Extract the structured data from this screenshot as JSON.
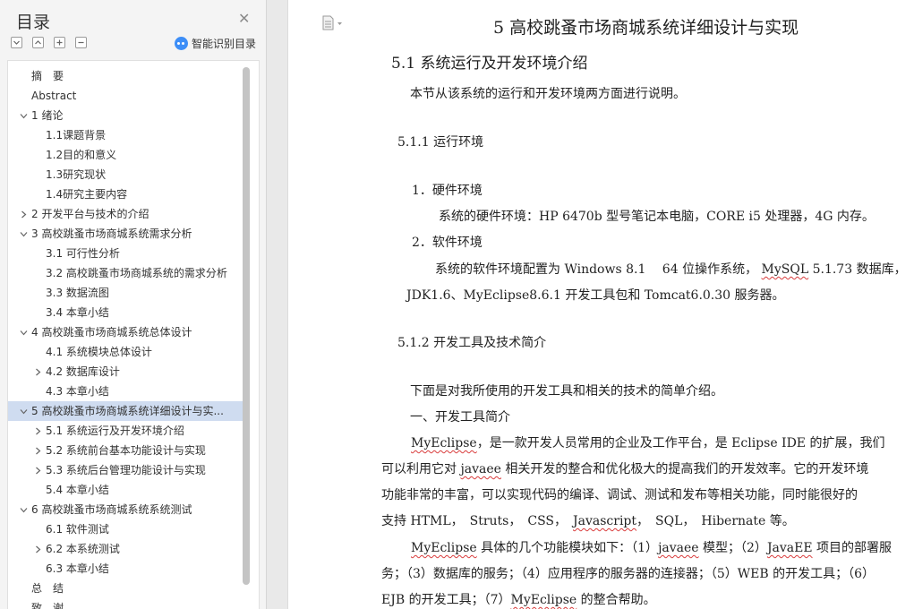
{
  "nav": {
    "title": "目录",
    "smart_toc_label": "智能识别目录",
    "items": [
      {
        "label": "摘　要",
        "level": 0,
        "expander": "none"
      },
      {
        "label": "Abstract",
        "level": 0,
        "expander": "none"
      },
      {
        "label": "1 绪论",
        "level": 0,
        "expander": "expanded"
      },
      {
        "label": "1.1课题背景",
        "level": 1,
        "expander": "none"
      },
      {
        "label": "1.2目的和意义",
        "level": 1,
        "expander": "none"
      },
      {
        "label": "1.3研究现状",
        "level": 1,
        "expander": "none"
      },
      {
        "label": "1.4研究主要内容",
        "level": 1,
        "expander": "none"
      },
      {
        "label": "2 开发平台与技术的介绍",
        "level": 0,
        "expander": "collapsed"
      },
      {
        "label": "3  高校跳蚤市场商城系统需求分析",
        "level": 0,
        "expander": "expanded"
      },
      {
        "label": "3.1 可行性分析",
        "level": 1,
        "expander": "none"
      },
      {
        "label": "3.2 高校跳蚤市场商城系统的需求分析",
        "level": 1,
        "expander": "none"
      },
      {
        "label": "3.3 数据流图",
        "level": 1,
        "expander": "none"
      },
      {
        "label": "3.4 本章小结",
        "level": 1,
        "expander": "none"
      },
      {
        "label": "4  高校跳蚤市场商城系统总体设计",
        "level": 0,
        "expander": "expanded"
      },
      {
        "label": "4.1 系统模块总体设计",
        "level": 1,
        "expander": "none"
      },
      {
        "label": "4.2 数据库设计",
        "level": 1,
        "expander": "collapsed"
      },
      {
        "label": "4.3 本章小结",
        "level": 1,
        "expander": "none"
      },
      {
        "label": "5  高校跳蚤市场商城系统详细设计与实...",
        "level": 0,
        "expander": "expanded",
        "active": true
      },
      {
        "label": "5.1 系统运行及开发环境介绍",
        "level": 1,
        "expander": "collapsed"
      },
      {
        "label": "5.2 系统前台基本功能设计与实现",
        "level": 1,
        "expander": "collapsed"
      },
      {
        "label": "5.3 系统后台管理功能设计与实现",
        "level": 1,
        "expander": "collapsed"
      },
      {
        "label": "5.4 本章小结",
        "level": 1,
        "expander": "none"
      },
      {
        "label": "6  高校跳蚤市场商城系统系统测试",
        "level": 0,
        "expander": "expanded"
      },
      {
        "label": "6.1 软件测试",
        "level": 1,
        "expander": "none"
      },
      {
        "label": "6.2 本系统测试",
        "level": 1,
        "expander": "collapsed"
      },
      {
        "label": "6.3 本章小结",
        "level": 1,
        "expander": "none"
      },
      {
        "label": "总　结",
        "level": 0,
        "expander": "none"
      },
      {
        "label": "致　谢",
        "level": 0,
        "expander": "none"
      }
    ]
  },
  "doc": {
    "chapter_title": "5  高校跳蚤市场商城系统详细设计与实现",
    "section_51": "5.1 系统运行及开发环境介绍",
    "intro": "本节从该系统的运行和开发环境两方面进行说明。",
    "sub_511": "5.1.1 运行环境",
    "hw_title": "1．硬件环境",
    "hw_body": "系统的硬件环境：HP 6470b 型号笔记本电脑，CORE i5 处理器，4G 内存。",
    "sw_title": "2．软件环境",
    "sw_body_1a": "系统的软件环境配置为 Windows 8.1　 64 位操作系统， ",
    "sw_body_1b": "MySQL",
    "sw_body_1c": " 5.1.73 数据库，",
    "sw_body_2": "JDK1.6、MyEclipse8.6.1 开发工具包和 Tomcat6.0.30 服务器。",
    "sub_512": "5.1.2 开发工具及技术简介",
    "p_intro": "下面是对我所使用的开发工具和相关的技术的简单介绍。",
    "p_tools_title": "一、开发工具简介",
    "p1_a": "MyEclipse",
    "p1_b": "，是一款开发人员常用的企业及工作平台，是 Eclipse IDE 的扩展，我们",
    "p2_a": "可以利用它对 ",
    "p2_b": "javaee",
    "p2_c": " 相关开发的整合和优化极大的提高我们的开发效率。它的开发环境",
    "p3": "功能非常的丰富，可以实现代码的编译、调试、测试和发布等相关功能，同时能很好的",
    "p4_a": "支持 HTML，　Struts，　CSS，　",
    "p4_b": "Javascript",
    "p4_c": "，　SQL，　Hibernate 等。",
    "p5_a": "MyEclipse",
    "p5_b": " 具体的几个功能模块如下：（1）",
    "p5_c": "javaee",
    "p5_d": " 模型；（2）",
    "p5_e": "JavaEE",
    "p5_f": " 项目的部署服",
    "p6": "务；（3）数据库的服务；（4）应用程序的服务器的连接器；（5）WEB 的开发工具；（6）",
    "p7_a": "EJB 的开发工具；（7）",
    "p7_b": "MyEclipse",
    "p7_c": " 的整合帮助。"
  },
  "icons": {
    "close": "close-icon",
    "expand_all": "expand-all-icon",
    "collapse_all": "collapse-all-icon",
    "add": "add-heading-icon",
    "remove": "remove-heading-icon",
    "smart": "ai-icon",
    "page": "document-icon"
  },
  "colors": {
    "active_row": "#cfdcf0",
    "accent": "#3d8ef7",
    "spell_underline": "#d93c3c"
  }
}
